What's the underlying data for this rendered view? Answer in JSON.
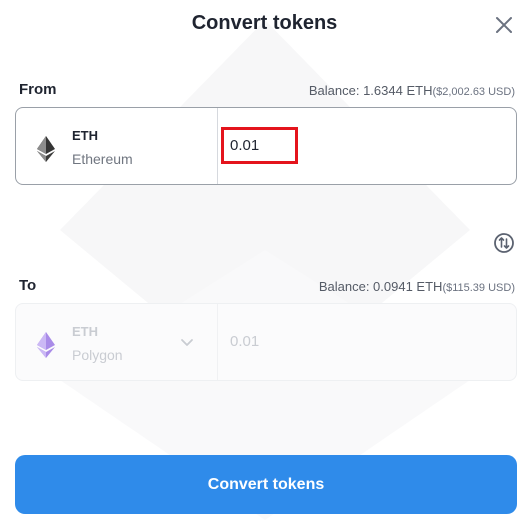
{
  "dialog": {
    "title": "Convert tokens"
  },
  "from": {
    "label": "From",
    "balance_label": "Balance: 1.6344 ETH",
    "balance_usd": "($2,002.63 USD)",
    "token_symbol": "ETH",
    "token_network": "Ethereum",
    "amount": "0.01"
  },
  "to": {
    "label": "To",
    "balance_label": "Balance: 0.0941 ETH",
    "balance_usd": "($115.39 USD)",
    "token_symbol": "ETH",
    "token_network": "Polygon",
    "amount": "0.01"
  },
  "actions": {
    "convert_label": "Convert tokens"
  },
  "icons": {
    "close": "close-icon",
    "swap": "swap-icon",
    "eth": "ethereum-icon",
    "chevron": "chevron-down-icon"
  },
  "colors": {
    "accent": "#2f8bea",
    "highlight": "#e4141c",
    "polygon_eth": "#b79cf0"
  }
}
